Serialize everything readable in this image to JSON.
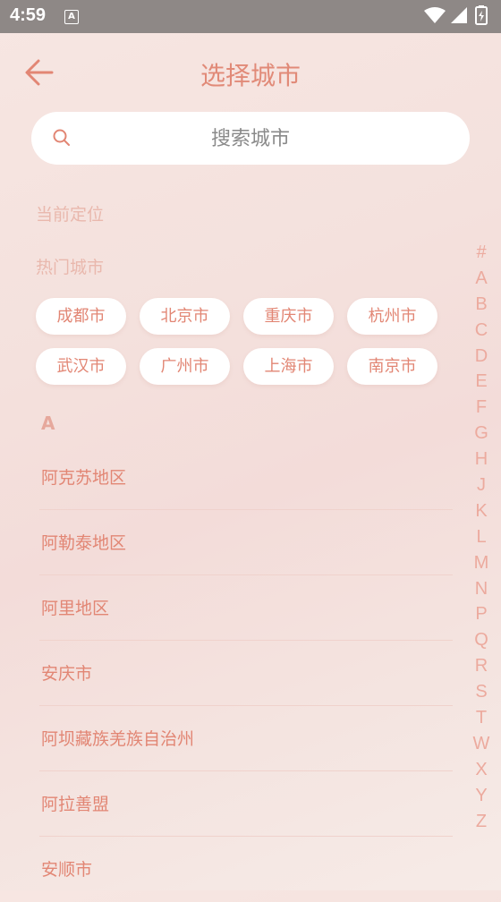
{
  "status_bar": {
    "time": "4:59",
    "notification_letter": "A"
  },
  "header": {
    "title": "选择城市"
  },
  "search": {
    "placeholder": "搜索城市"
  },
  "sections": {
    "current_location": "当前定位",
    "hot_cities": "热门城市"
  },
  "hot_cities": [
    "成都市",
    "北京市",
    "重庆市",
    "杭州市",
    "武汉市",
    "广州市",
    "上海市",
    "南京市"
  ],
  "group_letter": "A",
  "cities": [
    "阿克苏地区",
    "阿勒泰地区",
    "阿里地区",
    "安庆市",
    "阿坝藏族羌族自治州",
    "阿拉善盟",
    "安顺市"
  ],
  "index_letters": [
    "#",
    "A",
    "B",
    "C",
    "D",
    "E",
    "F",
    "G",
    "H",
    "J",
    "K",
    "L",
    "M",
    "N",
    "P",
    "Q",
    "R",
    "S",
    "T",
    "W",
    "X",
    "Y",
    "Z"
  ],
  "colors": {
    "accent": "#e28674",
    "muted_label": "#e9b8ad",
    "status_bar": "#8e8886"
  }
}
